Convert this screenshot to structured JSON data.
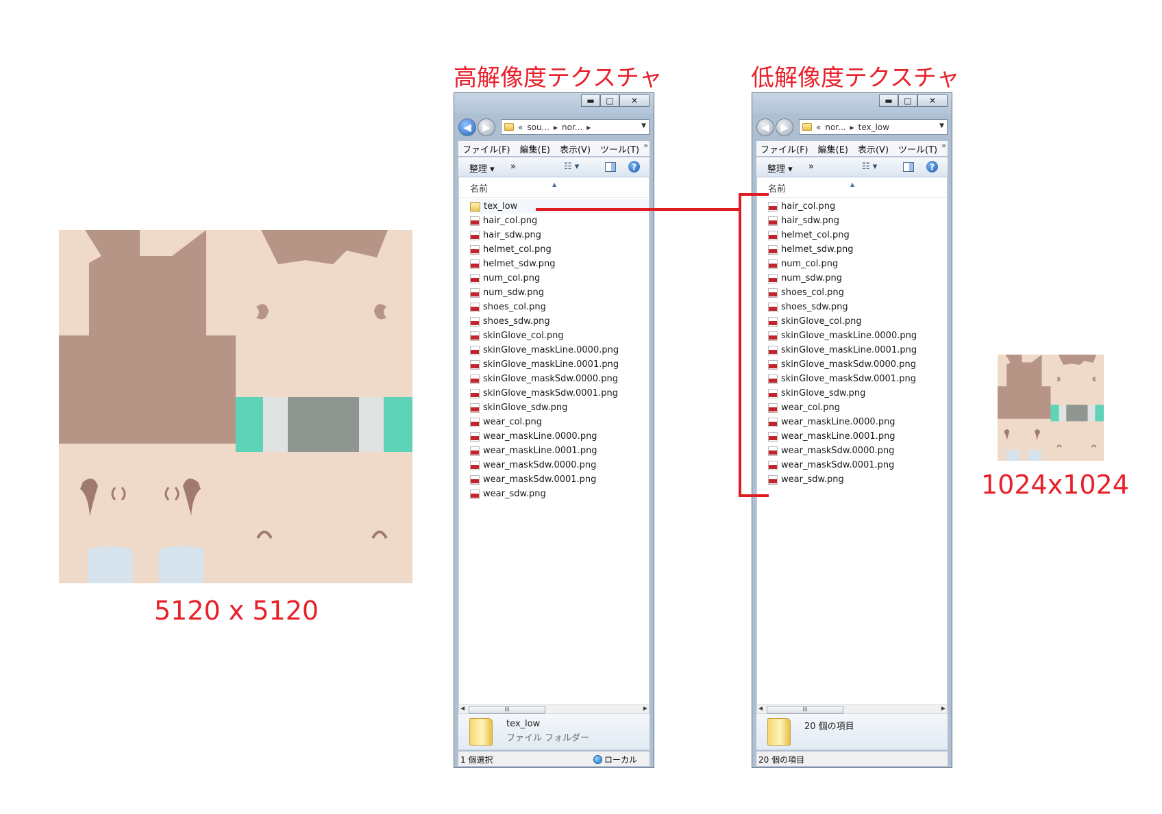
{
  "captions": {
    "high_res": "高解像度テクスチャ",
    "low_res": "低解像度テクスチャ",
    "size_large": "5120 x 5120",
    "size_small": "1024x1024"
  },
  "colors": {
    "caption_red": "#e8202a",
    "skin": "#efd9c8",
    "hair": "#b79586",
    "teal": "#5ed3b8",
    "grey": "#8f9590",
    "light_grey": "#e0e2e1",
    "pale_blue": "#d7e3ec"
  },
  "window_high": {
    "address": {
      "chevron": "«",
      "crumbs": [
        "sou...",
        "nor..."
      ],
      "sep": "▸"
    },
    "menu": [
      "ファイル(F)",
      "編集(E)",
      "表示(V)",
      "ツール(T)"
    ],
    "toolbar": {
      "organize": "整理 ▾",
      "more": "»"
    },
    "column_name": "名前",
    "files": [
      {
        "name": "tex_low",
        "kind": "folder"
      },
      {
        "name": "hair_col.png",
        "kind": "png"
      },
      {
        "name": "hair_sdw.png",
        "kind": "png"
      },
      {
        "name": "helmet_col.png",
        "kind": "png"
      },
      {
        "name": "helmet_sdw.png",
        "kind": "png"
      },
      {
        "name": "num_col.png",
        "kind": "png"
      },
      {
        "name": "num_sdw.png",
        "kind": "png"
      },
      {
        "name": "shoes_col.png",
        "kind": "png"
      },
      {
        "name": "shoes_sdw.png",
        "kind": "png"
      },
      {
        "name": "skinGlove_col.png",
        "kind": "png"
      },
      {
        "name": "skinGlove_maskLine.0000.png",
        "kind": "png"
      },
      {
        "name": "skinGlove_maskLine.0001.png",
        "kind": "png"
      },
      {
        "name": "skinGlove_maskSdw.0000.png",
        "kind": "png"
      },
      {
        "name": "skinGlove_maskSdw.0001.png",
        "kind": "png"
      },
      {
        "name": "skinGlove_sdw.png",
        "kind": "png"
      },
      {
        "name": "wear_col.png",
        "kind": "png"
      },
      {
        "name": "wear_maskLine.0000.png",
        "kind": "png"
      },
      {
        "name": "wear_maskLine.0001.png",
        "kind": "png"
      },
      {
        "name": "wear_maskSdw.0000.png",
        "kind": "png"
      },
      {
        "name": "wear_maskSdw.0001.png",
        "kind": "png"
      },
      {
        "name": "wear_sdw.png",
        "kind": "png"
      }
    ],
    "details": {
      "name": "tex_low",
      "type": "ファイル フォルダー"
    },
    "status_left": "1 個選択",
    "status_right": "ローカル",
    "scroll_thumb": "III"
  },
  "window_low": {
    "address": {
      "chevron": "«",
      "crumbs": [
        "nor...",
        "tex_low"
      ],
      "sep": "▸"
    },
    "menu": [
      "ファイル(F)",
      "編集(E)",
      "表示(V)",
      "ツール(T)"
    ],
    "toolbar": {
      "organize": "整理 ▾",
      "more": "»"
    },
    "column_name": "名前",
    "files": [
      {
        "name": "hair_col.png",
        "kind": "png"
      },
      {
        "name": "hair_sdw.png",
        "kind": "png"
      },
      {
        "name": "helmet_col.png",
        "kind": "png"
      },
      {
        "name": "helmet_sdw.png",
        "kind": "png"
      },
      {
        "name": "num_col.png",
        "kind": "png"
      },
      {
        "name": "num_sdw.png",
        "kind": "png"
      },
      {
        "name": "shoes_col.png",
        "kind": "png"
      },
      {
        "name": "shoes_sdw.png",
        "kind": "png"
      },
      {
        "name": "skinGlove_col.png",
        "kind": "png"
      },
      {
        "name": "skinGlove_maskLine.0000.png",
        "kind": "png"
      },
      {
        "name": "skinGlove_maskLine.0001.png",
        "kind": "png"
      },
      {
        "name": "skinGlove_maskSdw.0000.png",
        "kind": "png"
      },
      {
        "name": "skinGlove_maskSdw.0001.png",
        "kind": "png"
      },
      {
        "name": "skinGlove_sdw.png",
        "kind": "png"
      },
      {
        "name": "wear_col.png",
        "kind": "png"
      },
      {
        "name": "wear_maskLine.0000.png",
        "kind": "png"
      },
      {
        "name": "wear_maskLine.0001.png",
        "kind": "png"
      },
      {
        "name": "wear_maskSdw.0000.png",
        "kind": "png"
      },
      {
        "name": "wear_maskSdw.0001.png",
        "kind": "png"
      },
      {
        "name": "wear_sdw.png",
        "kind": "png"
      }
    ],
    "details": {
      "name": "20 個の項目",
      "type": ""
    },
    "status_left": "20 個の項目",
    "status_right": "",
    "scroll_thumb": "III"
  }
}
